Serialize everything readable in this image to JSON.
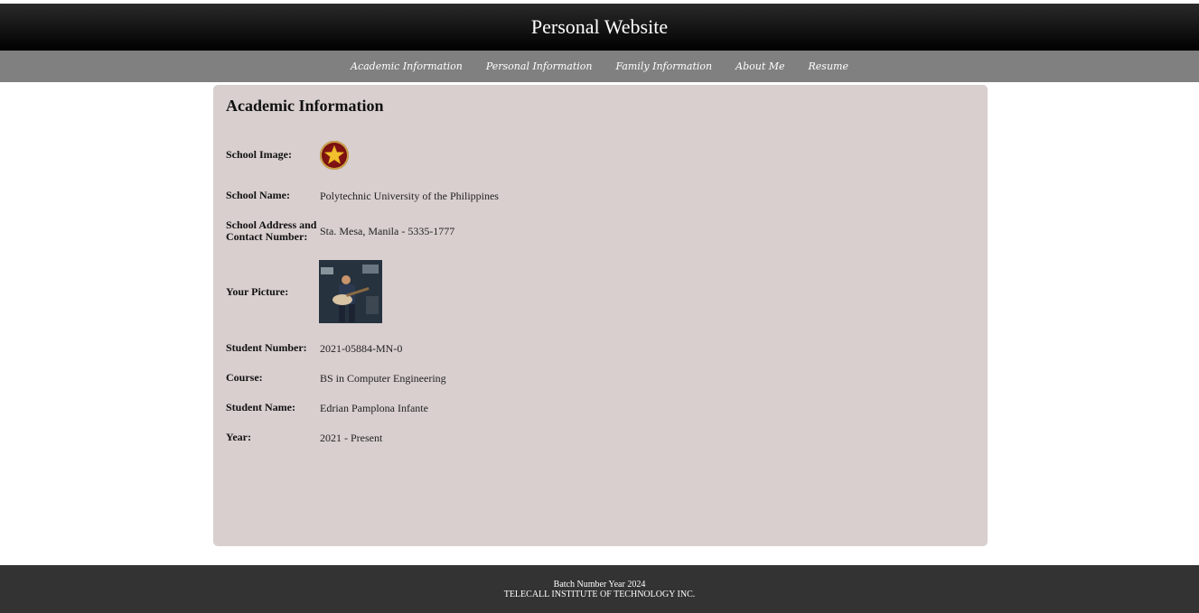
{
  "header": {
    "title": "Personal Website"
  },
  "nav": {
    "items": [
      {
        "label": "Academic Information"
      },
      {
        "label": "Personal Information"
      },
      {
        "label": "Family Information"
      },
      {
        "label": "About Me"
      },
      {
        "label": "Resume"
      }
    ]
  },
  "main": {
    "title": "Academic Information",
    "rows": {
      "school_image": {
        "label": "School Image:"
      },
      "school_name": {
        "label": "School Name:",
        "value": "Polytechnic University of the Philippines"
      },
      "school_address": {
        "label_line1": "School Address and",
        "label_line2": "Contact Number:",
        "value": "Sta. Mesa, Manila - 5335-1777"
      },
      "your_picture": {
        "label": "Your Picture:"
      },
      "student_number": {
        "label": "Student Number:",
        "value": "2021-05884-MN-0"
      },
      "course": {
        "label": "Course:",
        "value": "BS in Computer Engineering"
      },
      "student_name": {
        "label": "Student Name:",
        "value": "Edrian Pamplona Infante"
      },
      "year": {
        "label": "Year:",
        "value": "2021 - Present"
      }
    }
  },
  "footer": {
    "line1": "Batch Number Year 2024",
    "line2": "TELECALL INSTITUTE OF TECHNOLOGY INC."
  },
  "colors": {
    "header_bg": "#000000",
    "nav_bg": "#808080",
    "panel_bg": "#d9cfcf",
    "footer_bg": "#333333"
  }
}
